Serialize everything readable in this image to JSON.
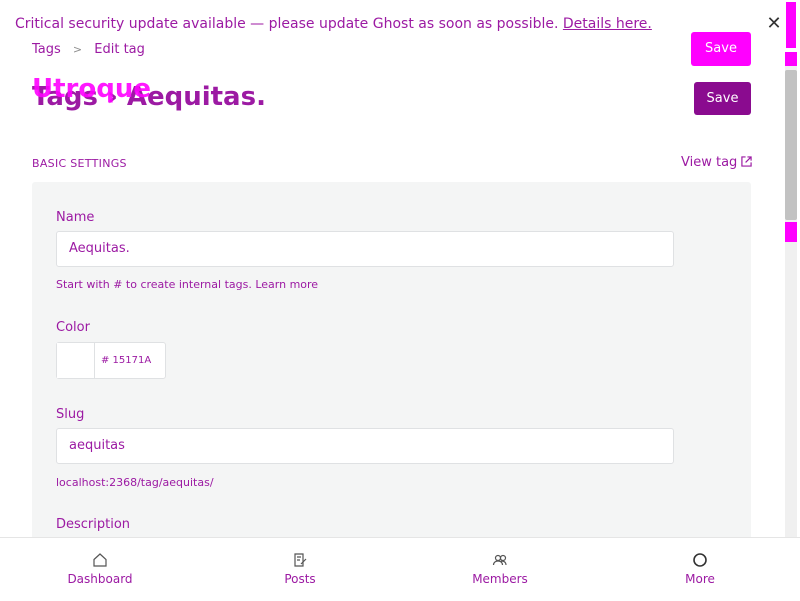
{
  "banner": {
    "message": "Critical security update available — please update Ghost as soon as possible.",
    "link_text": "Details here."
  },
  "breadcrumb": {
    "parent": "Tags",
    "separator": ">",
    "current": "Edit tag"
  },
  "header": {
    "title": "Tags › Aequitas.",
    "title_overlay": "Utroque",
    "save_top_label": "Save",
    "save_label": "Save"
  },
  "section": {
    "heading": "BASIC SETTINGS",
    "view_tag_label": "View tag"
  },
  "form": {
    "name": {
      "label": "Name",
      "value": "Aequitas.",
      "hint": "Start with # to create internal tags. Learn more"
    },
    "color": {
      "label": "Color",
      "value": "# 15171A"
    },
    "slug": {
      "label": "Slug",
      "value": "aequitas",
      "url": "localhost:2368/tag/aequitas/"
    },
    "description": {
      "label": "Description"
    }
  },
  "bottom_nav": {
    "items": [
      {
        "label": "Dashboard",
        "icon": "house-icon"
      },
      {
        "label": "Posts",
        "icon": "edit-document-icon"
      },
      {
        "label": "Members",
        "icon": "members-icon"
      },
      {
        "label": "More",
        "icon": "circle-icon"
      }
    ]
  },
  "colors": {
    "accent": "#9c1aa3",
    "highlight": "#ff00ff",
    "save_button": "#8a0b8f",
    "panel_bg": "#f4f5f5"
  }
}
